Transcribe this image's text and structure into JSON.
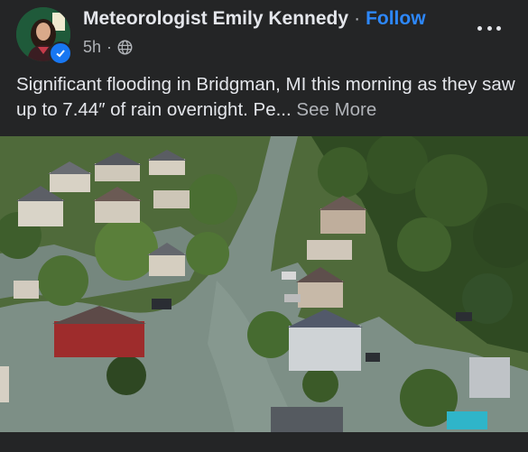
{
  "post": {
    "author": "Meteorologist Emily Kennedy",
    "separator": "·",
    "follow_label": "Follow",
    "time": "5h",
    "time_separator": "·",
    "audience_icon": "globe-icon",
    "caption": "Significant flooding in Bridgman, MI this morning as they saw up to 7.44″ of rain overnight. Pe...",
    "see_more_label": "See More",
    "more_icon": "more-options-icon"
  },
  "colors": {
    "background": "#242526",
    "text": "#e4e6eb",
    "secondary_text": "#b0b3b8",
    "follow": "#2d88ff",
    "verified_badge": "#1877f2",
    "flood_water": "#7d8f86"
  }
}
